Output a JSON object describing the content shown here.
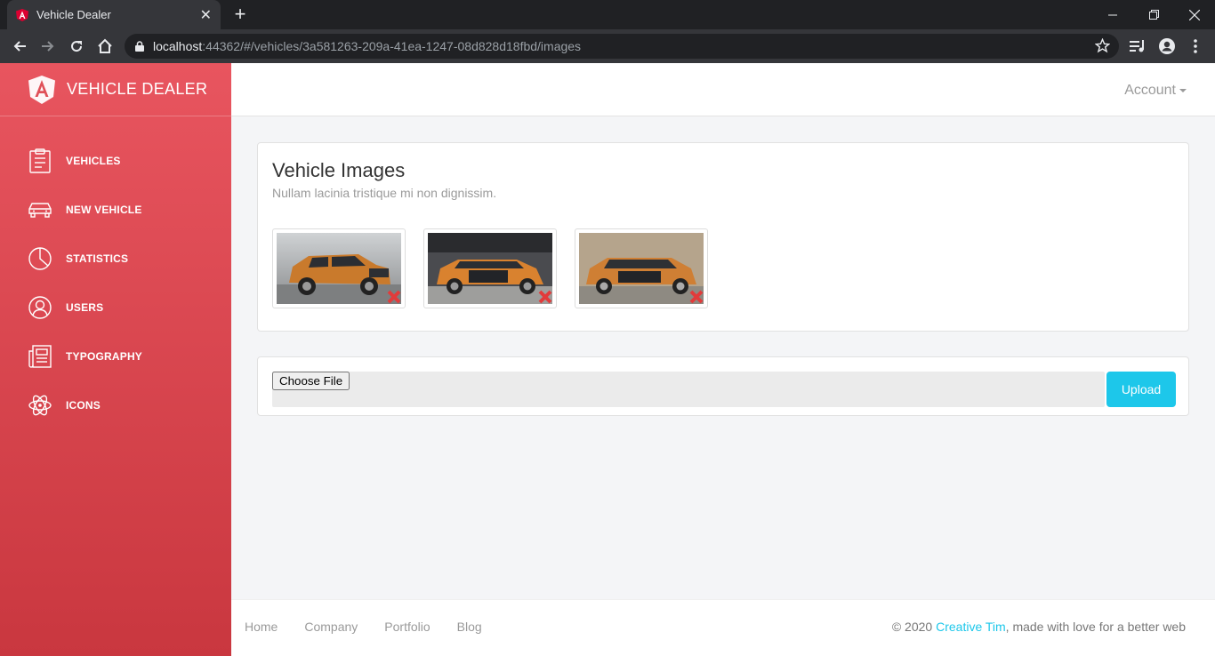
{
  "browser": {
    "tab_title": "Vehicle Dealer",
    "url_host": "localhost",
    "url_path": ":44362/#/vehicles/3a581263-209a-41ea-1247-08d828d18fbd/images"
  },
  "sidebar": {
    "brand": "VEHICLE DEALER",
    "items": [
      {
        "label": "VEHICLES",
        "icon": "clipboard-icon"
      },
      {
        "label": "NEW VEHICLE",
        "icon": "car-icon"
      },
      {
        "label": "STATISTICS",
        "icon": "pie-chart-icon"
      },
      {
        "label": "USERS",
        "icon": "user-icon"
      },
      {
        "label": "TYPOGRAPHY",
        "icon": "news-icon"
      },
      {
        "label": "ICONS",
        "icon": "atom-icon"
      }
    ]
  },
  "topnav": {
    "account_label": "Account"
  },
  "images_card": {
    "title": "Vehicle Images",
    "subtitle": "Nullam lacinia tristique mi non dignissim.",
    "images": [
      {
        "alt": "vehicle-image-1"
      },
      {
        "alt": "vehicle-image-2"
      },
      {
        "alt": "vehicle-image-3"
      }
    ]
  },
  "upload_card": {
    "button_label": "Upload"
  },
  "footer": {
    "links": [
      "Home",
      "Company",
      "Portfolio",
      "Blog"
    ],
    "copyright_prefix": "© 2020 ",
    "copyright_author": "Creative Tim",
    "copyright_suffix": ", made with love for a better web"
  },
  "colors": {
    "sidebar_top": "#e8555f",
    "sidebar_bottom": "#c9373f",
    "accent": "#1dc7ea",
    "delete_red": "#e23b3b"
  }
}
